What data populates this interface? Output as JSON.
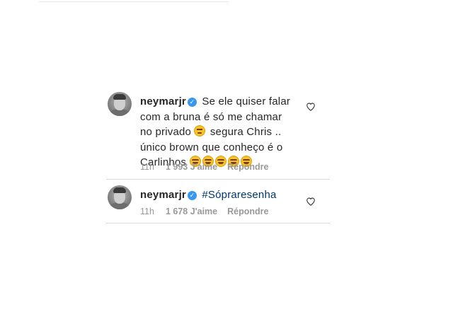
{
  "comments": [
    {
      "username": "neymarjr",
      "verified": true,
      "lines": [
        "Se ele quiser falar",
        "com a bruna é só me chamar no",
        "privado",
        "segura Chris .. único",
        "brown que conheço é o",
        "Carlinhos"
      ],
      "emoji_wink": "winking-face-emoji",
      "emoji_laugh_count": 5,
      "time": "11h",
      "likes": "1 993 J'aime",
      "reply_label": "Répondre"
    },
    {
      "username": "neymarjr",
      "verified": true,
      "hashtag": "#Sópraresenha",
      "time": "11h",
      "likes": "1 678 J'aime",
      "reply_label": "Répondre"
    }
  ],
  "colors": {
    "verified_badge": "#3897f0",
    "hashtag": "#003569",
    "meta_text": "#999999",
    "divider": "#dbdbdb"
  }
}
